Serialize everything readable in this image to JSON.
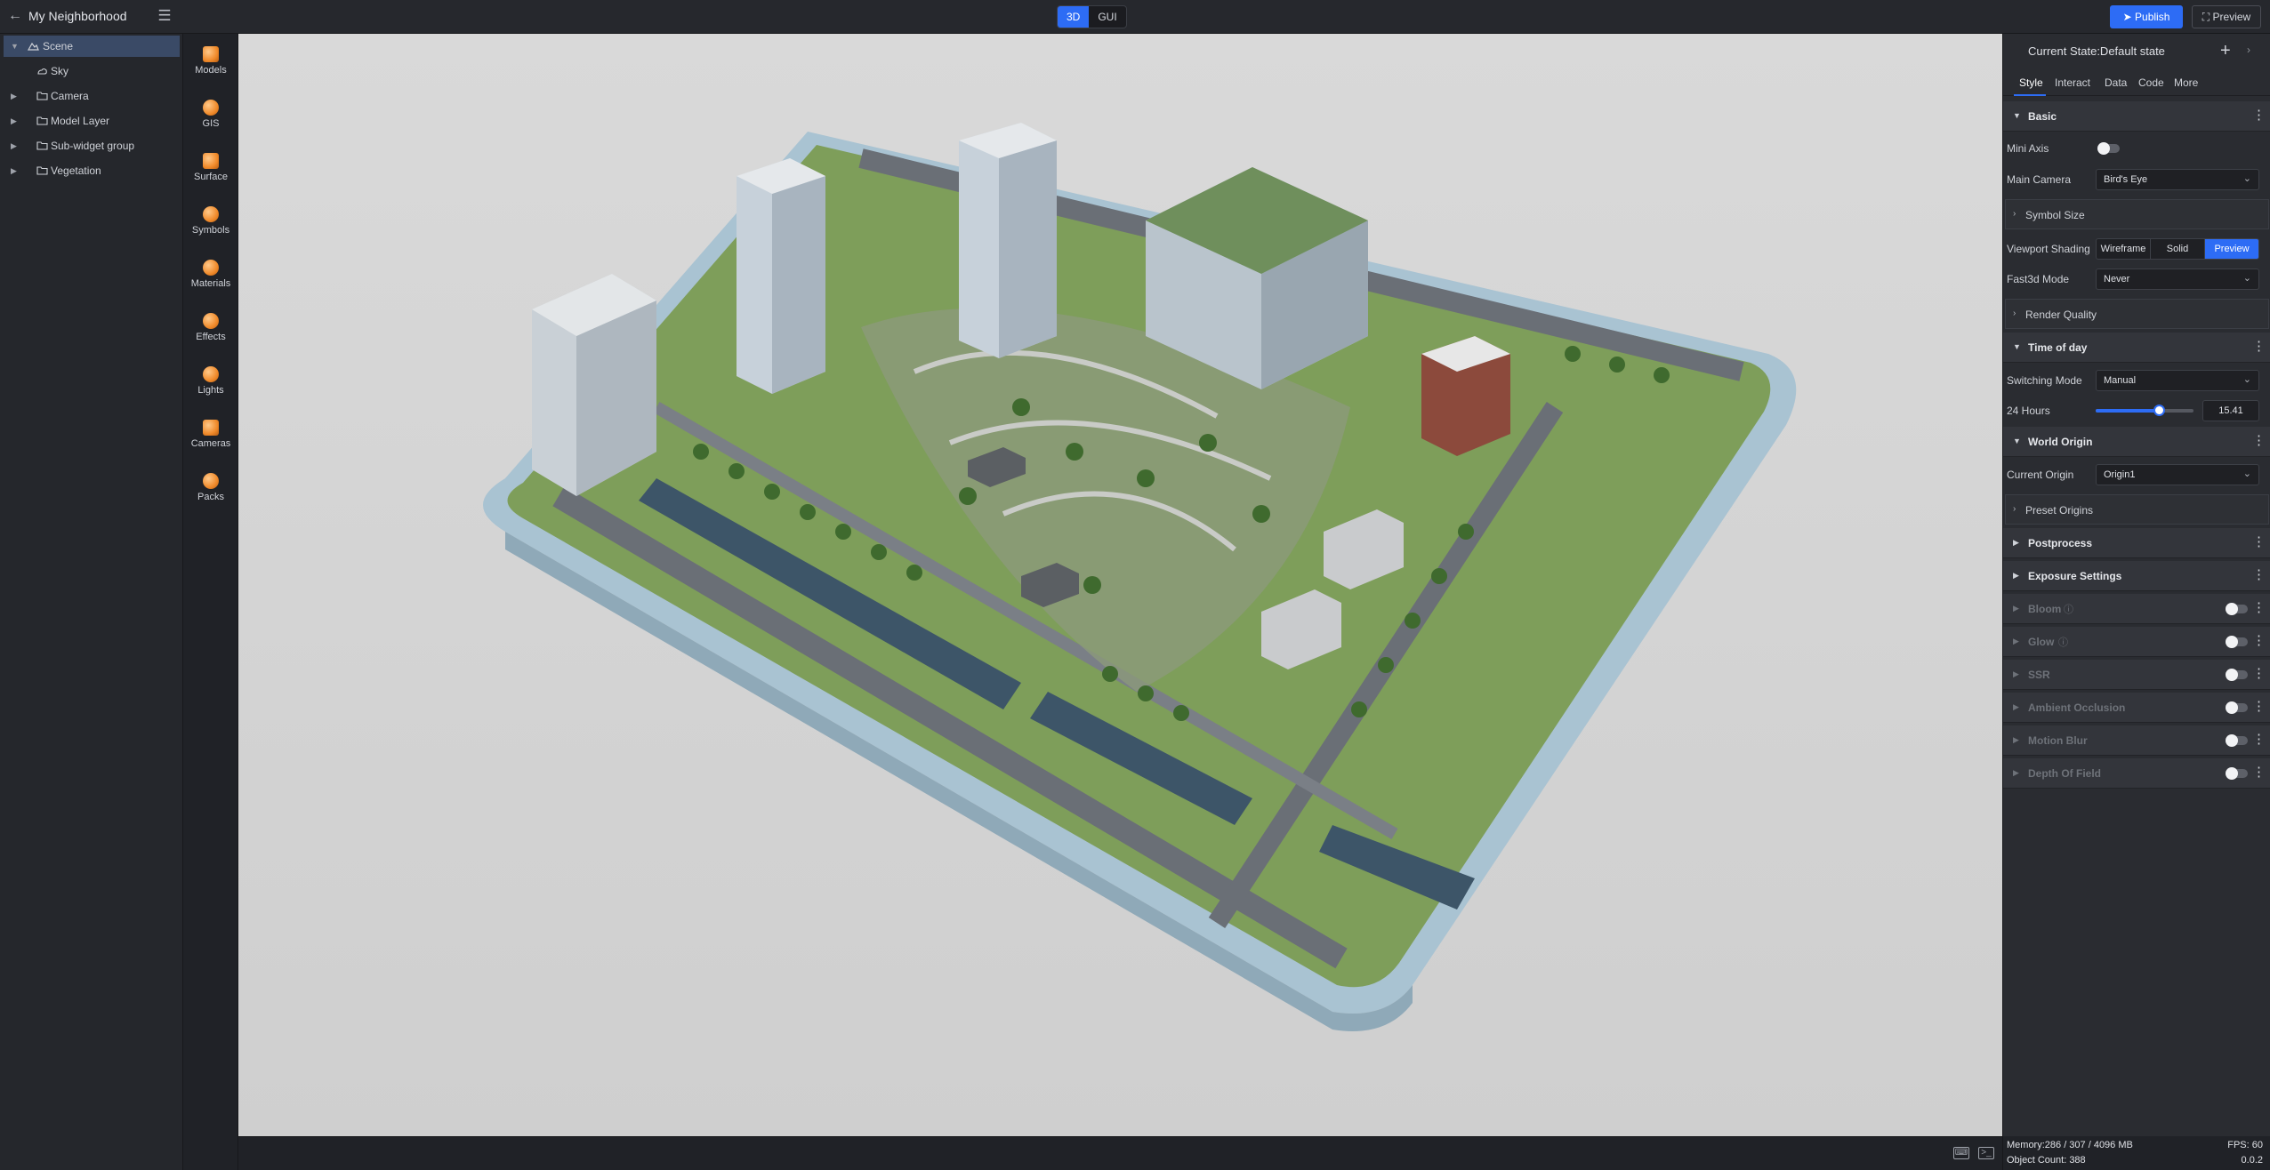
{
  "app": {
    "title": "My Neighborhood"
  },
  "mode_switch": {
    "options": [
      "3D",
      "GUI"
    ],
    "active": "3D"
  },
  "header": {
    "publish_label": "Publish",
    "preview_label": "Preview"
  },
  "tree": [
    {
      "label": "Scene",
      "selected": true
    },
    {
      "label": "Sky"
    },
    {
      "label": "Camera"
    },
    {
      "label": "Model Layer"
    },
    {
      "label": "Sub-widget group"
    },
    {
      "label": "Vegetation"
    }
  ],
  "toolbox": [
    "Models",
    "GIS",
    "Surface",
    "Symbols",
    "Materials",
    "Effects",
    "Lights",
    "Cameras",
    "Packs"
  ],
  "props": {
    "state_title": "Current State:Default state",
    "tabs": [
      "Style",
      "Interact",
      "Data",
      "Code",
      "More"
    ],
    "active_tab": "Style",
    "basic": {
      "title": "Basic",
      "mini_axis_label": "Mini Axis",
      "main_camera_label": "Main Camera",
      "main_camera_value": "Bird's Eye",
      "symbol_size_label": "Symbol Size",
      "viewport_shading_label": "Viewport Shading",
      "shading_options": [
        "Wireframe",
        "Solid",
        "Preview"
      ],
      "shading_active": "Preview",
      "fast3d_label": "Fast3d Mode",
      "fast3d_value": "Never",
      "render_quality_label": "Render Quality"
    },
    "time_of_day": {
      "title": "Time of day",
      "switching_mode_label": "Switching Mode",
      "switching_mode_value": "Manual",
      "hours_label": "24 Hours",
      "hours_value": "15.41",
      "hours_fraction": 0.642
    },
    "world_origin": {
      "title": "World Origin",
      "current_origin_label": "Current Origin",
      "current_origin_value": "Origin1",
      "preset_origins_label": "Preset Origins"
    },
    "postprocess": {
      "title": "Postprocess"
    },
    "exposure": {
      "title": "Exposure Settings"
    },
    "effects": [
      {
        "label": "Bloom",
        "help": true
      },
      {
        "label": "Glow",
        "help": true
      },
      {
        "label": "SSR"
      },
      {
        "label": "Ambient Occlusion"
      },
      {
        "label": "Motion Blur"
      },
      {
        "label": "Depth Of Field"
      }
    ]
  },
  "stats": {
    "memory": "Memory:286 / 307 / 4096 MB",
    "fps": "FPS: 60",
    "object_count": "Object Count: 388",
    "version": "0.0.2"
  }
}
